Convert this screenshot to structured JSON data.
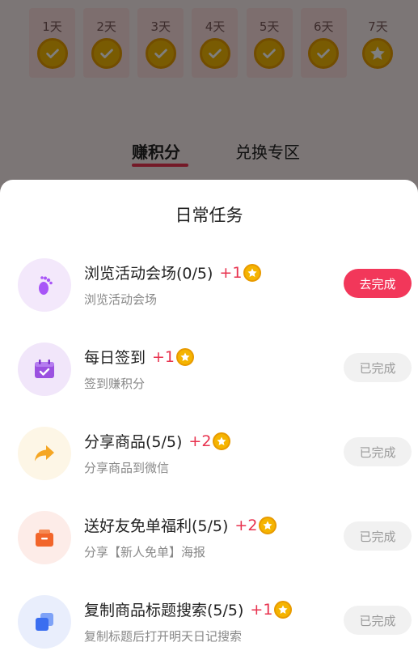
{
  "background": {
    "checkin_days": [
      {
        "label": "1天",
        "status": "checked"
      },
      {
        "label": "2天",
        "status": "checked"
      },
      {
        "label": "3天",
        "status": "checked"
      },
      {
        "label": "4天",
        "status": "checked"
      },
      {
        "label": "5天",
        "status": "checked"
      },
      {
        "label": "6天",
        "status": "checked"
      },
      {
        "label": "7天",
        "status": "star"
      }
    ],
    "tabs": [
      {
        "label": "赚积分",
        "active": true
      },
      {
        "label": "兑换专区",
        "active": false
      }
    ]
  },
  "sheet": {
    "title": "日常任务",
    "tasks": [
      {
        "title": "浏览活动会场(0/5)",
        "points": "+1",
        "desc": "浏览活动会场",
        "button": "去完成",
        "icon": "footprint-icon"
      },
      {
        "title": "每日签到",
        "points": "+1",
        "desc": "签到赚积分",
        "button": "已完成",
        "icon": "calendar-check-icon"
      },
      {
        "title": "分享商品(5/5)",
        "points": "+2",
        "desc": "分享商品到微信",
        "button": "已完成",
        "icon": "share-arrow-icon"
      },
      {
        "title": "送好友免单福利(5/5)",
        "points": "+2",
        "desc": "分享【新人免单】海报",
        "button": "已完成",
        "icon": "gift-box-icon"
      },
      {
        "title": "复制商品标题搜索(5/5)",
        "points": "+1",
        "desc": "复制标题后打开明天日记搜索",
        "button": "已完成",
        "icon": "copy-icon"
      }
    ]
  },
  "colors": {
    "accent": "#f2375a",
    "points": "#e8334f",
    "coin": "#f2b705"
  }
}
